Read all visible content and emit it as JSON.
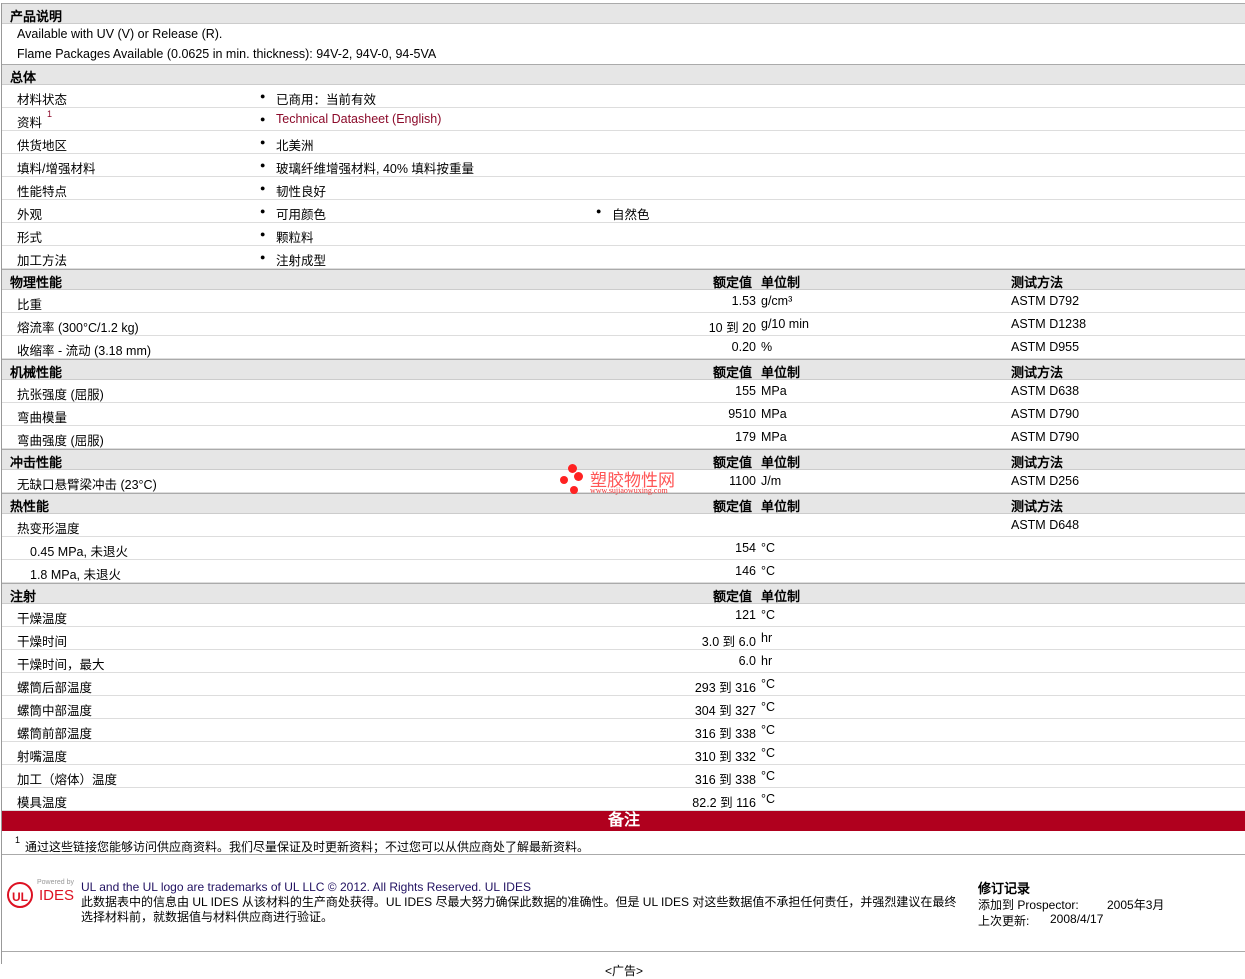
{
  "desc": {
    "title": "产品说明",
    "lines": [
      "Available with UV (V) or Release (R).",
      "Flame Packages Available (0.0625 in min. thickness): 94V-2, 94V-0, 94-5VA"
    ]
  },
  "general": {
    "title": "总体",
    "rows": [
      {
        "label": "材料状态",
        "v1": "已商用：当前有效"
      },
      {
        "label": "资料",
        "sup": "1",
        "v1": "Technical Datasheet (English)"
      },
      {
        "label": "供货地区",
        "v1": "北美洲"
      },
      {
        "label": "填料/增强材料",
        "v1": "玻璃纤维增强材料, 40% 填料按重量"
      },
      {
        "label": "性能特点",
        "v1": "韧性良好"
      },
      {
        "label": "外观",
        "v1": "可用颜色",
        "v2": "自然色"
      },
      {
        "label": "形式",
        "v1": "颗粒料"
      },
      {
        "label": "加工方法",
        "v1": "注射成型"
      }
    ]
  },
  "cols": {
    "value": "额定值",
    "unit": "单位制",
    "method": "测试方法"
  },
  "physical": {
    "title": "物理性能",
    "rows": [
      {
        "label": "比重",
        "value": "1.53",
        "unit": "g/cm³",
        "method": "ASTM D792"
      },
      {
        "label": "熔流率  (300°C/1.2 kg)",
        "value": "10 到  20",
        "unit": "g/10 min",
        "method": "ASTM D1238"
      },
      {
        "label": "收缩率  - 流动  (3.18 mm)",
        "value": "0.20",
        "unit": "%",
        "method": "ASTM D955"
      }
    ]
  },
  "mechanical": {
    "title": "机械性能",
    "rows": [
      {
        "label": "抗张强度  (屈服)",
        "value": "155",
        "unit": "MPa",
        "method": "ASTM D638"
      },
      {
        "label": "弯曲模量",
        "value": "9510",
        "unit": "MPa",
        "method": "ASTM D790"
      },
      {
        "label": "弯曲强度  (屈服)",
        "value": "179",
        "unit": "MPa",
        "method": "ASTM D790"
      }
    ]
  },
  "impact": {
    "title": "冲击性能",
    "rows": [
      {
        "label": "无缺口悬臂梁冲击  (23°C)",
        "value": "1100",
        "unit": "J/m",
        "method": "ASTM D256"
      }
    ]
  },
  "thermal": {
    "title": "热性能",
    "rows": [
      {
        "label": "热变形温度",
        "value": "",
        "unit": "",
        "method": "ASTM D648"
      },
      {
        "label": "0.45 MPa, 未退火",
        "value": "154",
        "unit": "°C",
        "method": "",
        "indent": true
      },
      {
        "label": "1.8 MPa, 未退火",
        "value": "146",
        "unit": "°C",
        "method": "",
        "indent": true
      }
    ]
  },
  "injection": {
    "title": "注射",
    "rows": [
      {
        "label": "干燥温度",
        "value": "121",
        "unit": "°C"
      },
      {
        "label": "干燥时间",
        "value": "3.0 到  6.0",
        "unit": "hr"
      },
      {
        "label": "干燥时间，最大",
        "value": "6.0",
        "unit": "hr"
      },
      {
        "label": "螺筒后部温度",
        "value": "293 到  316",
        "unit": "°C"
      },
      {
        "label": "螺筒中部温度",
        "value": "304 到  327",
        "unit": "°C"
      },
      {
        "label": "螺筒前部温度",
        "value": "316 到  338",
        "unit": "°C"
      },
      {
        "label": "射嘴温度",
        "value": "310 到  332",
        "unit": "°C"
      },
      {
        "label": "加工（熔体）温度",
        "value": "316 到  338",
        "unit": "°C"
      },
      {
        "label": "模具温度",
        "value": "82.2 到  116",
        "unit": "°C"
      }
    ]
  },
  "notes": {
    "title": "备注",
    "sup": "1",
    "text": "通过这些链接您能够访问供应商资料。我们尽量保证及时更新资料；不过您可以从供应商处了解最新资料。"
  },
  "watermark": {
    "name": "塑胶物性网",
    "url": "www.sujiaowuxing.com"
  },
  "footer": {
    "logo_powered": "Powered by",
    "logo_text": "IDES",
    "line1": "UL and the UL logo are trademarks of UL LLC © 2012. All Rights Reserved. UL IDES",
    "line2": "此数据表中的信息由  UL IDES 从该材料的生产商处获得。UL IDES 尽最大努力确保此数据的准确性。但是  UL IDES 对这些数据值不承担任何责任，并强烈建议在最终选择材料前，就数据值与材料供应商进行验证。",
    "rev_title": "修订记录",
    "added_label": "添加到  Prospector:",
    "added_value": "2005年3月",
    "updated_label": "上次更新:",
    "updated_value": "2008/4/17"
  },
  "ad": "<广告>"
}
